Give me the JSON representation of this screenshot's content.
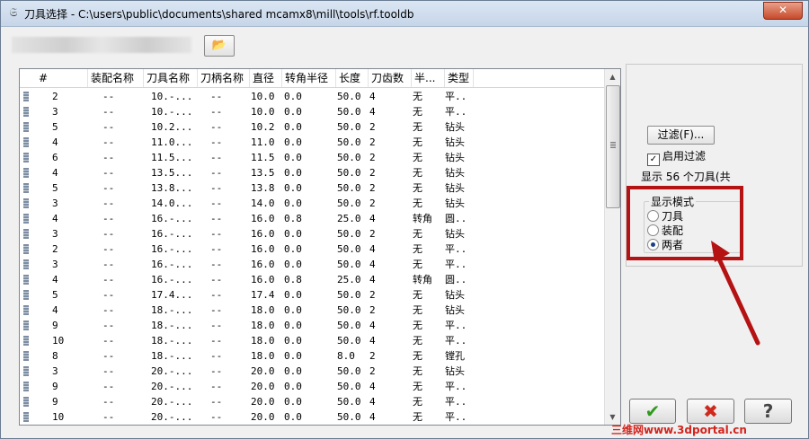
{
  "window": {
    "title": "刀具选择 - C:\\users\\public\\documents\\shared mcamx8\\mill\\tools\\rf.tooldb",
    "close_label": "✕"
  },
  "icons": {
    "app": "mastercam-icon",
    "folder": "open-folder-icon",
    "ok": "checkmark-icon",
    "cancel": "cross-icon",
    "help": "question-icon"
  },
  "columns": [
    "#",
    "装配名称",
    "刀具名称",
    "刀柄名称",
    "直径",
    "转角半径",
    "长度",
    "刀齿数",
    "半...",
    "类型"
  ],
  "rows": [
    [
      "2",
      "--",
      "10.-...",
      "--",
      "10.0",
      "0.0",
      "50.0",
      "4",
      "无",
      "平.."
    ],
    [
      "3",
      "--",
      "10.-...",
      "--",
      "10.0",
      "0.0",
      "50.0",
      "4",
      "无",
      "平.."
    ],
    [
      "5",
      "--",
      "10.2...",
      "--",
      "10.2",
      "0.0",
      "50.0",
      "2",
      "无",
      "钻头"
    ],
    [
      "4",
      "--",
      "11.0...",
      "--",
      "11.0",
      "0.0",
      "50.0",
      "2",
      "无",
      "钻头"
    ],
    [
      "6",
      "--",
      "11.5...",
      "--",
      "11.5",
      "0.0",
      "50.0",
      "2",
      "无",
      "钻头"
    ],
    [
      "4",
      "--",
      "13.5...",
      "--",
      "13.5",
      "0.0",
      "50.0",
      "2",
      "无",
      "钻头"
    ],
    [
      "5",
      "--",
      "13.8...",
      "--",
      "13.8",
      "0.0",
      "50.0",
      "2",
      "无",
      "钻头"
    ],
    [
      "3",
      "--",
      "14.0...",
      "--",
      "14.0",
      "0.0",
      "50.0",
      "2",
      "无",
      "钻头"
    ],
    [
      "4",
      "--",
      "16.-...",
      "--",
      "16.0",
      "0.8",
      "25.0",
      "4",
      "转角",
      "圆.."
    ],
    [
      "3",
      "--",
      "16.-...",
      "--",
      "16.0",
      "0.0",
      "50.0",
      "2",
      "无",
      "钻头"
    ],
    [
      "2",
      "--",
      "16.-...",
      "--",
      "16.0",
      "0.0",
      "50.0",
      "4",
      "无",
      "平.."
    ],
    [
      "3",
      "--",
      "16.-...",
      "--",
      "16.0",
      "0.0",
      "50.0",
      "4",
      "无",
      "平.."
    ],
    [
      "4",
      "--",
      "16.-...",
      "--",
      "16.0",
      "0.8",
      "25.0",
      "4",
      "转角",
      "圆.."
    ],
    [
      "5",
      "--",
      "17.4...",
      "--",
      "17.4",
      "0.0",
      "50.0",
      "2",
      "无",
      "钻头"
    ],
    [
      "4",
      "--",
      "18.-...",
      "--",
      "18.0",
      "0.0",
      "50.0",
      "2",
      "无",
      "钻头"
    ],
    [
      "9",
      "--",
      "18.-...",
      "--",
      "18.0",
      "0.0",
      "50.0",
      "4",
      "无",
      "平.."
    ],
    [
      "10",
      "--",
      "18.-...",
      "--",
      "18.0",
      "0.0",
      "50.0",
      "4",
      "无",
      "平.."
    ],
    [
      "8",
      "--",
      "18.-...",
      "--",
      "18.0",
      "0.0",
      "8.0",
      "2",
      "无",
      "镗孔"
    ],
    [
      "3",
      "--",
      "20.-...",
      "--",
      "20.0",
      "0.0",
      "50.0",
      "2",
      "无",
      "钻头"
    ],
    [
      "9",
      "--",
      "20.-...",
      "--",
      "20.0",
      "0.0",
      "50.0",
      "4",
      "无",
      "平.."
    ],
    [
      "9",
      "--",
      "20.-...",
      "--",
      "20.0",
      "0.0",
      "50.0",
      "4",
      "无",
      "平.."
    ],
    [
      "10",
      "--",
      "20.-...",
      "--",
      "20.0",
      "0.0",
      "50.0",
      "4",
      "无",
      "平.."
    ]
  ],
  "filter": {
    "button_label": "过滤(F)...",
    "enable_label": "启用过滤",
    "enabled": true,
    "count_text": "显示 56 个刀具(共"
  },
  "display_mode": {
    "title": "显示模式",
    "options": [
      "刀具",
      "装配",
      "两者"
    ],
    "selected": "两者"
  },
  "buttons": {
    "ok": "✔",
    "cancel": "✖",
    "help": "?"
  },
  "watermark": "三维网www.3dportal.cn",
  "colors": {
    "annotation_red": "#b51213",
    "ok_green": "#2f9b1c",
    "cancel_red": "#d0281b"
  }
}
